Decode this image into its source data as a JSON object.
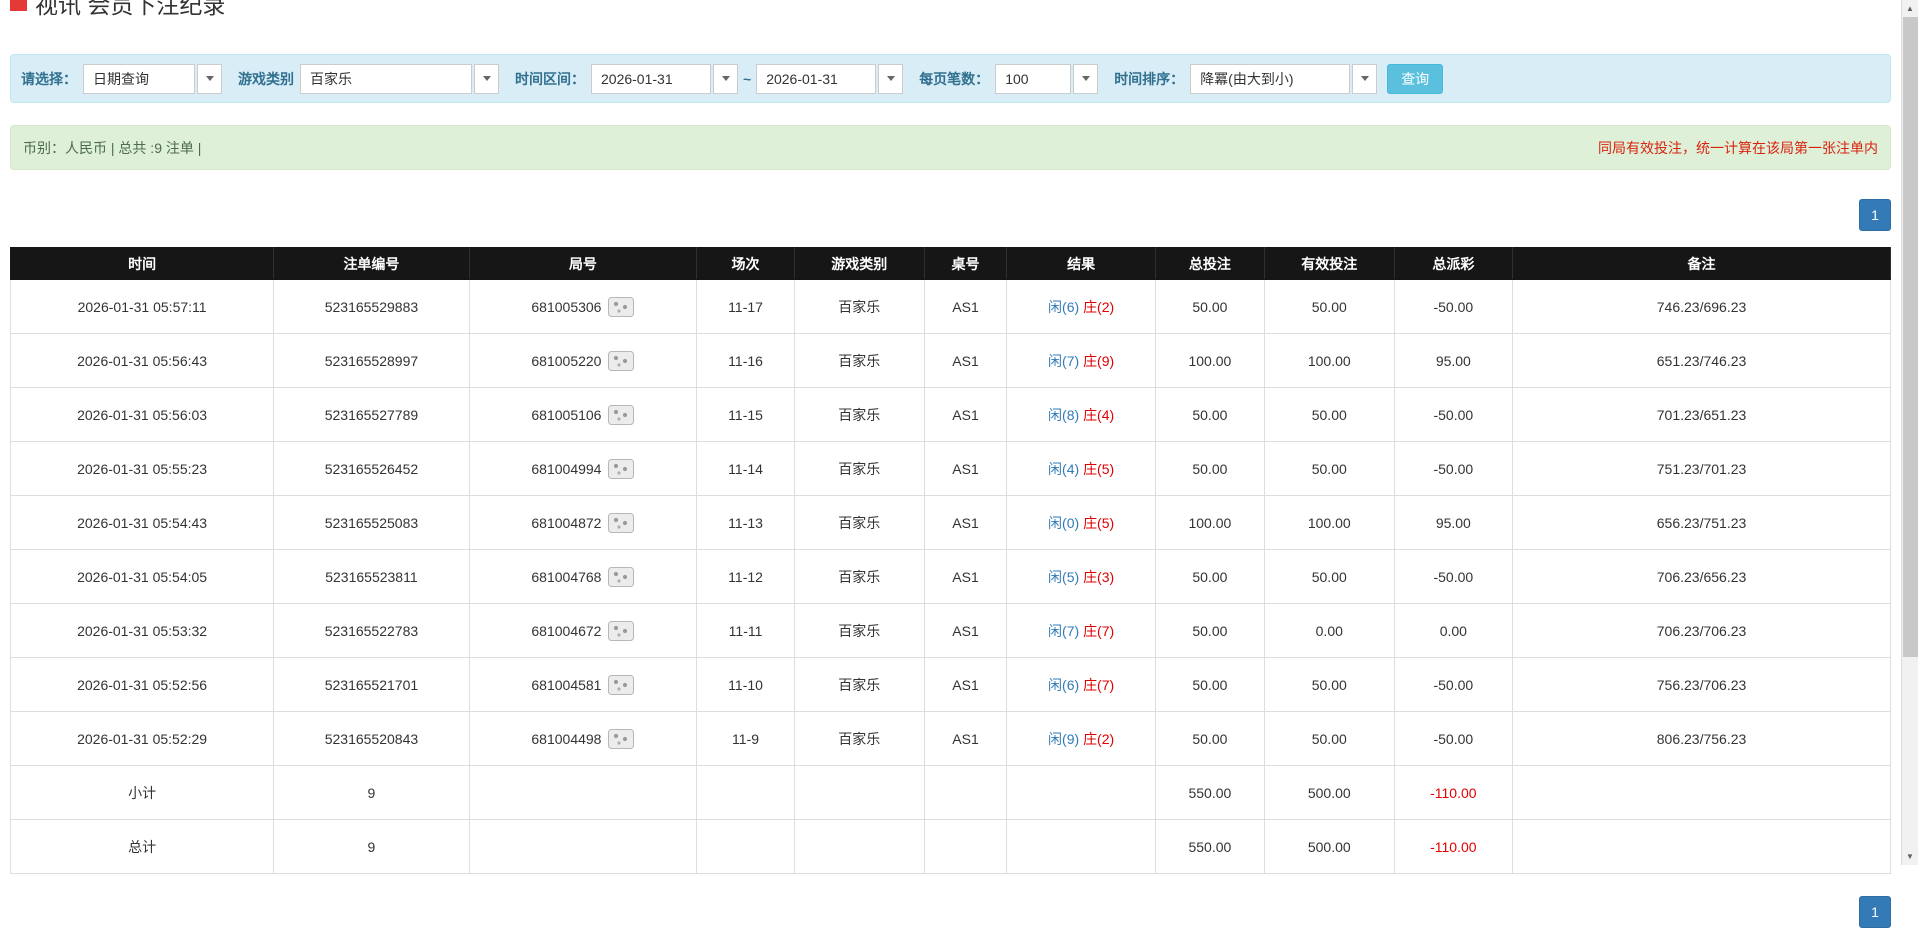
{
  "page": {
    "title": "视讯 会员下注纪录"
  },
  "filters": {
    "select_label": "请选择：",
    "select_value": "日期查询",
    "game_label": "游戏类别",
    "game_value": "百家乐",
    "range_label": "时间区间：",
    "date_from": "2026-01-31",
    "range_separator": "~",
    "date_to": "2026-01-31",
    "per_page_label": "每页笔数：",
    "per_page_value": "100",
    "sort_label": "时间排序：",
    "sort_value": "降冪(由大到小)",
    "query_button": "查询"
  },
  "summary": {
    "left_text": "币别：人民币 | 总共 :9 注单 |",
    "right_note": "同局有效投注，统一计算在该局第一张注单内"
  },
  "pagination": {
    "current_page": "1"
  },
  "table": {
    "headers": [
      "时间",
      "注单编号",
      "局号",
      "场次",
      "游戏类别",
      "桌号",
      "结果",
      "总投注",
      "有效投注",
      "总派彩",
      "备注"
    ],
    "rows": [
      {
        "time": "2026-01-31 05:57:11",
        "bet_id": "523165529883",
        "round": "681005306",
        "session": "11-17",
        "game": "百家乐",
        "table": "AS1",
        "player": "闲(6)",
        "banker": "庄(2)",
        "total_bet": "50.00",
        "valid_bet": "50.00",
        "payout": "-50.00",
        "note": "746.23/696.23"
      },
      {
        "time": "2026-01-31 05:56:43",
        "bet_id": "523165528997",
        "round": "681005220",
        "session": "11-16",
        "game": "百家乐",
        "table": "AS1",
        "player": "闲(7)",
        "banker": "庄(9)",
        "total_bet": "100.00",
        "valid_bet": "100.00",
        "payout": "95.00",
        "note": "651.23/746.23"
      },
      {
        "time": "2026-01-31 05:56:03",
        "bet_id": "523165527789",
        "round": "681005106",
        "session": "11-15",
        "game": "百家乐",
        "table": "AS1",
        "player": "闲(8)",
        "banker": "庄(4)",
        "total_bet": "50.00",
        "valid_bet": "50.00",
        "payout": "-50.00",
        "note": "701.23/651.23"
      },
      {
        "time": "2026-01-31 05:55:23",
        "bet_id": "523165526452",
        "round": "681004994",
        "session": "11-14",
        "game": "百家乐",
        "table": "AS1",
        "player": "闲(4)",
        "banker": "庄(5)",
        "total_bet": "50.00",
        "valid_bet": "50.00",
        "payout": "-50.00",
        "note": "751.23/701.23"
      },
      {
        "time": "2026-01-31 05:54:43",
        "bet_id": "523165525083",
        "round": "681004872",
        "session": "11-13",
        "game": "百家乐",
        "table": "AS1",
        "player": "闲(0)",
        "banker": "庄(5)",
        "total_bet": "100.00",
        "valid_bet": "100.00",
        "payout": "95.00",
        "note": "656.23/751.23"
      },
      {
        "time": "2026-01-31 05:54:05",
        "bet_id": "523165523811",
        "round": "681004768",
        "session": "11-12",
        "game": "百家乐",
        "table": "AS1",
        "player": "闲(5)",
        "banker": "庄(3)",
        "total_bet": "50.00",
        "valid_bet": "50.00",
        "payout": "-50.00",
        "note": "706.23/656.23"
      },
      {
        "time": "2026-01-31 05:53:32",
        "bet_id": "523165522783",
        "round": "681004672",
        "session": "11-11",
        "game": "百家乐",
        "table": "AS1",
        "player": "闲(7)",
        "banker": "庄(7)",
        "total_bet": "50.00",
        "valid_bet": "0.00",
        "payout": "0.00",
        "note": "706.23/706.23"
      },
      {
        "time": "2026-01-31 05:52:56",
        "bet_id": "523165521701",
        "round": "681004581",
        "session": "11-10",
        "game": "百家乐",
        "table": "AS1",
        "player": "闲(6)",
        "banker": "庄(7)",
        "total_bet": "50.00",
        "valid_bet": "50.00",
        "payout": "-50.00",
        "note": "756.23/706.23"
      },
      {
        "time": "2026-01-31 05:52:29",
        "bet_id": "523165520843",
        "round": "681004498",
        "session": "11-9",
        "game": "百家乐",
        "table": "AS1",
        "player": "闲(9)",
        "banker": "庄(2)",
        "total_bet": "50.00",
        "valid_bet": "50.00",
        "payout": "-50.00",
        "note": "806.23/756.23"
      }
    ],
    "subtotal": {
      "label": "小计",
      "count": "9",
      "total_bet": "550.00",
      "valid_bet": "500.00",
      "payout": "-110.00"
    },
    "total": {
      "label": "总计",
      "count": "9",
      "total_bet": "550.00",
      "valid_bet": "500.00",
      "payout": "-110.00"
    }
  },
  "icons": {
    "chevron-down-icon": "▼",
    "replay-icon": "dice-thumbnail",
    "scroll-up-icon": "▲",
    "scroll-down-icon": "▼",
    "brand-square-icon": "red-square"
  },
  "colors": {
    "accent_blue": "#337ab7",
    "danger_red": "#e00000",
    "table_header_bg": "#161616",
    "table_footer_bg": "#9d9d9d",
    "filter_bar_bg": "#d9edf7",
    "summary_bar_bg": "#dff0d8",
    "query_button_bg": "#5bc0de",
    "brand_red": "#e53935"
  }
}
